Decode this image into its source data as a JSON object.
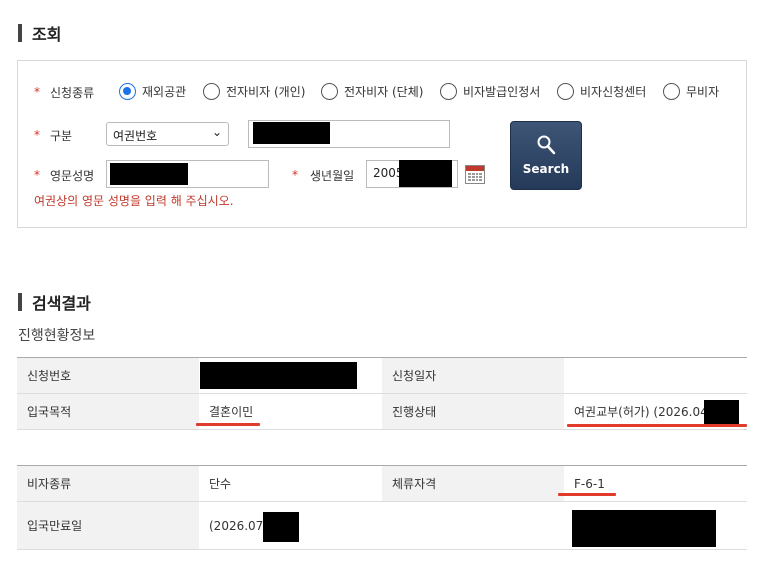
{
  "inquiry": {
    "title": "조회",
    "application_type": {
      "label": "신청종류",
      "options": [
        "재외공관",
        "전자비자 (개인)",
        "전자비자 (단체)",
        "비자발급인정서",
        "비자신청센터",
        "무비자"
      ],
      "selected": "재외공관"
    },
    "category": {
      "label": "구분",
      "selected": "여권번호"
    },
    "english_name": {
      "label": "영문성명"
    },
    "birth_date": {
      "label": "생년월일",
      "value": "2005-"
    },
    "hint": "여권상의 영문 성명을 입력 해 주십시오.",
    "search_button": "Search"
  },
  "results": {
    "title": "검색결과",
    "subtitle": "진행현황정보",
    "table1": [
      {
        "h1": "신청번호",
        "v1": "",
        "h2": "신청일자",
        "v2": ""
      },
      {
        "h1": "입국목적",
        "v1": "결혼이민",
        "h2": "진행상태",
        "v2": "여권교부(허가) (2026.04"
      }
    ],
    "table2": [
      {
        "h1": "비자종류",
        "v1": "단수",
        "h2": "체류자격",
        "v2": "F-6-1"
      },
      {
        "h1": "입국만료일",
        "v1": "(2026.07.",
        "h2": "",
        "v2": ""
      }
    ]
  },
  "colors": {
    "required": "#d9342b",
    "radio_selected": "#1a73e8",
    "search_button": "#2f4566",
    "annotation_underline": "#e03b2b"
  }
}
